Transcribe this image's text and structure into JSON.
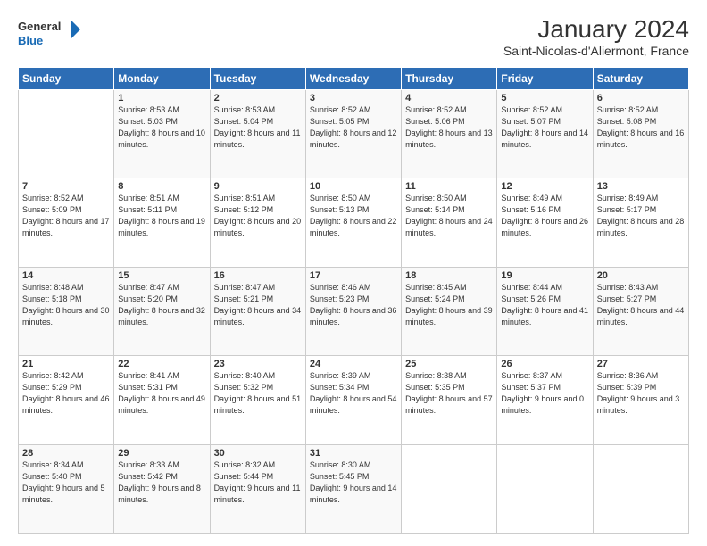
{
  "logo": {
    "line1": "General",
    "line2": "Blue"
  },
  "header": {
    "title": "January 2024",
    "subtitle": "Saint-Nicolas-d'Aliermont, France"
  },
  "weekdays": [
    "Sunday",
    "Monday",
    "Tuesday",
    "Wednesday",
    "Thursday",
    "Friday",
    "Saturday"
  ],
  "weeks": [
    [
      {
        "day": "",
        "sunrise": "",
        "sunset": "",
        "daylight": ""
      },
      {
        "day": "1",
        "sunrise": "Sunrise: 8:53 AM",
        "sunset": "Sunset: 5:03 PM",
        "daylight": "Daylight: 8 hours and 10 minutes."
      },
      {
        "day": "2",
        "sunrise": "Sunrise: 8:53 AM",
        "sunset": "Sunset: 5:04 PM",
        "daylight": "Daylight: 8 hours and 11 minutes."
      },
      {
        "day": "3",
        "sunrise": "Sunrise: 8:52 AM",
        "sunset": "Sunset: 5:05 PM",
        "daylight": "Daylight: 8 hours and 12 minutes."
      },
      {
        "day": "4",
        "sunrise": "Sunrise: 8:52 AM",
        "sunset": "Sunset: 5:06 PM",
        "daylight": "Daylight: 8 hours and 13 minutes."
      },
      {
        "day": "5",
        "sunrise": "Sunrise: 8:52 AM",
        "sunset": "Sunset: 5:07 PM",
        "daylight": "Daylight: 8 hours and 14 minutes."
      },
      {
        "day": "6",
        "sunrise": "Sunrise: 8:52 AM",
        "sunset": "Sunset: 5:08 PM",
        "daylight": "Daylight: 8 hours and 16 minutes."
      }
    ],
    [
      {
        "day": "7",
        "sunrise": "Sunrise: 8:52 AM",
        "sunset": "Sunset: 5:09 PM",
        "daylight": "Daylight: 8 hours and 17 minutes."
      },
      {
        "day": "8",
        "sunrise": "Sunrise: 8:51 AM",
        "sunset": "Sunset: 5:11 PM",
        "daylight": "Daylight: 8 hours and 19 minutes."
      },
      {
        "day": "9",
        "sunrise": "Sunrise: 8:51 AM",
        "sunset": "Sunset: 5:12 PM",
        "daylight": "Daylight: 8 hours and 20 minutes."
      },
      {
        "day": "10",
        "sunrise": "Sunrise: 8:50 AM",
        "sunset": "Sunset: 5:13 PM",
        "daylight": "Daylight: 8 hours and 22 minutes."
      },
      {
        "day": "11",
        "sunrise": "Sunrise: 8:50 AM",
        "sunset": "Sunset: 5:14 PM",
        "daylight": "Daylight: 8 hours and 24 minutes."
      },
      {
        "day": "12",
        "sunrise": "Sunrise: 8:49 AM",
        "sunset": "Sunset: 5:16 PM",
        "daylight": "Daylight: 8 hours and 26 minutes."
      },
      {
        "day": "13",
        "sunrise": "Sunrise: 8:49 AM",
        "sunset": "Sunset: 5:17 PM",
        "daylight": "Daylight: 8 hours and 28 minutes."
      }
    ],
    [
      {
        "day": "14",
        "sunrise": "Sunrise: 8:48 AM",
        "sunset": "Sunset: 5:18 PM",
        "daylight": "Daylight: 8 hours and 30 minutes."
      },
      {
        "day": "15",
        "sunrise": "Sunrise: 8:47 AM",
        "sunset": "Sunset: 5:20 PM",
        "daylight": "Daylight: 8 hours and 32 minutes."
      },
      {
        "day": "16",
        "sunrise": "Sunrise: 8:47 AM",
        "sunset": "Sunset: 5:21 PM",
        "daylight": "Daylight: 8 hours and 34 minutes."
      },
      {
        "day": "17",
        "sunrise": "Sunrise: 8:46 AM",
        "sunset": "Sunset: 5:23 PM",
        "daylight": "Daylight: 8 hours and 36 minutes."
      },
      {
        "day": "18",
        "sunrise": "Sunrise: 8:45 AM",
        "sunset": "Sunset: 5:24 PM",
        "daylight": "Daylight: 8 hours and 39 minutes."
      },
      {
        "day": "19",
        "sunrise": "Sunrise: 8:44 AM",
        "sunset": "Sunset: 5:26 PM",
        "daylight": "Daylight: 8 hours and 41 minutes."
      },
      {
        "day": "20",
        "sunrise": "Sunrise: 8:43 AM",
        "sunset": "Sunset: 5:27 PM",
        "daylight": "Daylight: 8 hours and 44 minutes."
      }
    ],
    [
      {
        "day": "21",
        "sunrise": "Sunrise: 8:42 AM",
        "sunset": "Sunset: 5:29 PM",
        "daylight": "Daylight: 8 hours and 46 minutes."
      },
      {
        "day": "22",
        "sunrise": "Sunrise: 8:41 AM",
        "sunset": "Sunset: 5:31 PM",
        "daylight": "Daylight: 8 hours and 49 minutes."
      },
      {
        "day": "23",
        "sunrise": "Sunrise: 8:40 AM",
        "sunset": "Sunset: 5:32 PM",
        "daylight": "Daylight: 8 hours and 51 minutes."
      },
      {
        "day": "24",
        "sunrise": "Sunrise: 8:39 AM",
        "sunset": "Sunset: 5:34 PM",
        "daylight": "Daylight: 8 hours and 54 minutes."
      },
      {
        "day": "25",
        "sunrise": "Sunrise: 8:38 AM",
        "sunset": "Sunset: 5:35 PM",
        "daylight": "Daylight: 8 hours and 57 minutes."
      },
      {
        "day": "26",
        "sunrise": "Sunrise: 8:37 AM",
        "sunset": "Sunset: 5:37 PM",
        "daylight": "Daylight: 9 hours and 0 minutes."
      },
      {
        "day": "27",
        "sunrise": "Sunrise: 8:36 AM",
        "sunset": "Sunset: 5:39 PM",
        "daylight": "Daylight: 9 hours and 3 minutes."
      }
    ],
    [
      {
        "day": "28",
        "sunrise": "Sunrise: 8:34 AM",
        "sunset": "Sunset: 5:40 PM",
        "daylight": "Daylight: 9 hours and 5 minutes."
      },
      {
        "day": "29",
        "sunrise": "Sunrise: 8:33 AM",
        "sunset": "Sunset: 5:42 PM",
        "daylight": "Daylight: 9 hours and 8 minutes."
      },
      {
        "day": "30",
        "sunrise": "Sunrise: 8:32 AM",
        "sunset": "Sunset: 5:44 PM",
        "daylight": "Daylight: 9 hours and 11 minutes."
      },
      {
        "day": "31",
        "sunrise": "Sunrise: 8:30 AM",
        "sunset": "Sunset: 5:45 PM",
        "daylight": "Daylight: 9 hours and 14 minutes."
      },
      {
        "day": "",
        "sunrise": "",
        "sunset": "",
        "daylight": ""
      },
      {
        "day": "",
        "sunrise": "",
        "sunset": "",
        "daylight": ""
      },
      {
        "day": "",
        "sunrise": "",
        "sunset": "",
        "daylight": ""
      }
    ]
  ]
}
